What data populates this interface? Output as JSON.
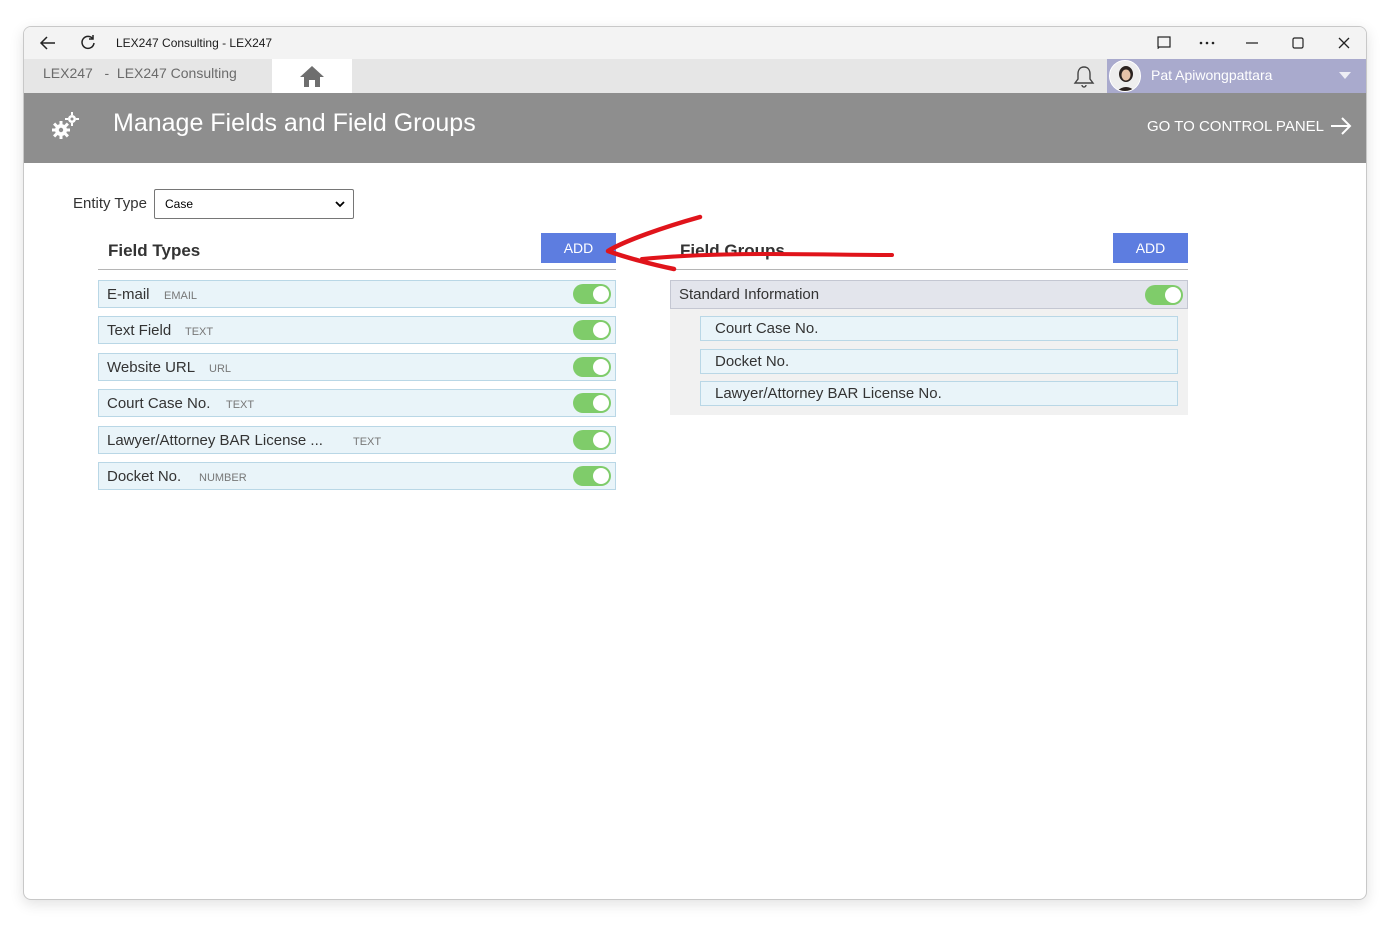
{
  "window": {
    "title": "LEX247 Consulting - LEX247"
  },
  "nav": {
    "breadcrumb": "LEX247   -  LEX247 Consulting",
    "user_name": "Pat Apiwongpattara"
  },
  "header": {
    "title": "Manage Fields and Field Groups",
    "control_panel_link": "GO TO CONTROL PANEL"
  },
  "entity": {
    "label": "Entity Type",
    "selected": "Case"
  },
  "field_types": {
    "title": "Field Types",
    "add_label": "ADD",
    "items": [
      {
        "name": "E-mail",
        "type": "EMAIL",
        "enabled": true
      },
      {
        "name": "Text Field",
        "type": "TEXT",
        "enabled": true
      },
      {
        "name": "Website URL",
        "type": "URL",
        "enabled": true
      },
      {
        "name": "Court Case No.",
        "type": "TEXT",
        "enabled": true
      },
      {
        "name": "Lawyer/Attorney BAR License ...",
        "type": "TEXT",
        "enabled": true
      },
      {
        "name": "Docket No.",
        "type": "NUMBER",
        "enabled": true
      }
    ]
  },
  "field_groups": {
    "title": "Field Groups",
    "add_label": "ADD",
    "groups": [
      {
        "name": "Standard Information",
        "enabled": true,
        "items": [
          "Court Case No.",
          "Docket No.",
          "Lawyer/Attorney BAR License No."
        ]
      }
    ]
  },
  "colors": {
    "header_bg": "#8e8e8e",
    "add_button": "#5d7de0",
    "toggle_on": "#7fcc6a",
    "row_bg": "#e9f4f9",
    "user_area": "#a9aacd",
    "annotation_arrow": "#e0141b"
  },
  "icons": [
    "back-arrow-icon",
    "refresh-icon",
    "cast-icon",
    "more-icon",
    "minimize-icon",
    "maximize-icon",
    "close-icon",
    "home-icon",
    "bell-icon",
    "gears-icon",
    "arrow-right-icon"
  ]
}
